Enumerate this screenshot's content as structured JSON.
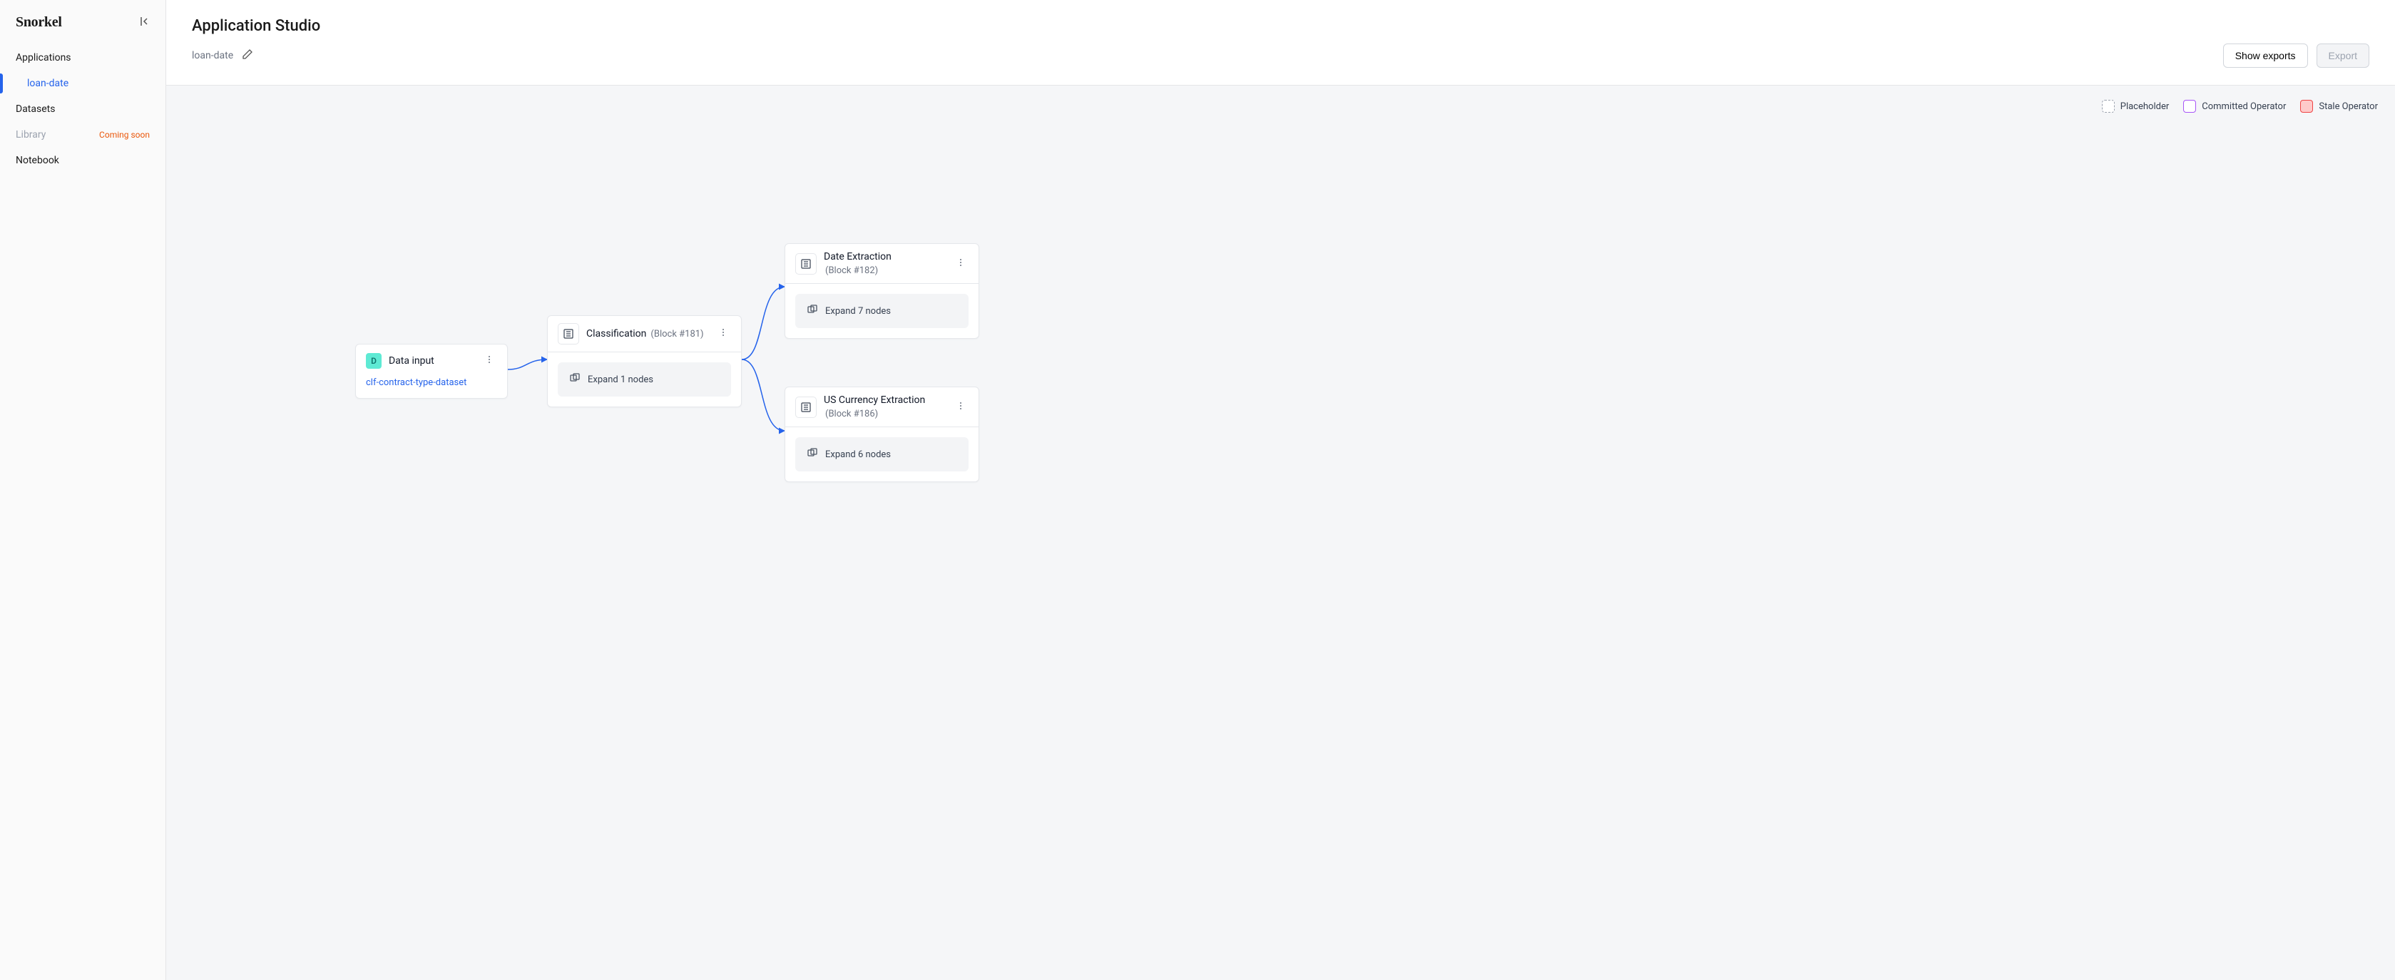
{
  "sidebar": {
    "logo": "Snorkel",
    "items": {
      "applications": "Applications",
      "loan_date": "loan-date",
      "datasets": "Datasets",
      "library": "Library",
      "coming_soon": "Coming soon",
      "notebook": "Notebook"
    }
  },
  "header": {
    "title": "Application Studio",
    "subtitle": "loan-date",
    "buttons": {
      "show_exports": "Show exports",
      "export": "Export"
    }
  },
  "legend": {
    "placeholder": "Placeholder",
    "committed": "Committed Operator",
    "stale": "Stale Operator"
  },
  "nodes": {
    "data_input": {
      "title": "Data input",
      "link": "clf-contract-type-dataset",
      "badge": "D"
    },
    "classification": {
      "title": "Classification",
      "block": "(Block #181)",
      "expand": "Expand 1 nodes"
    },
    "date_extraction": {
      "title": "Date Extraction",
      "block": "(Block #182)",
      "expand": "Expand 7 nodes"
    },
    "us_currency": {
      "title": "US Currency Extraction",
      "block": "(Block #186)",
      "expand": "Expand 6 nodes"
    }
  }
}
